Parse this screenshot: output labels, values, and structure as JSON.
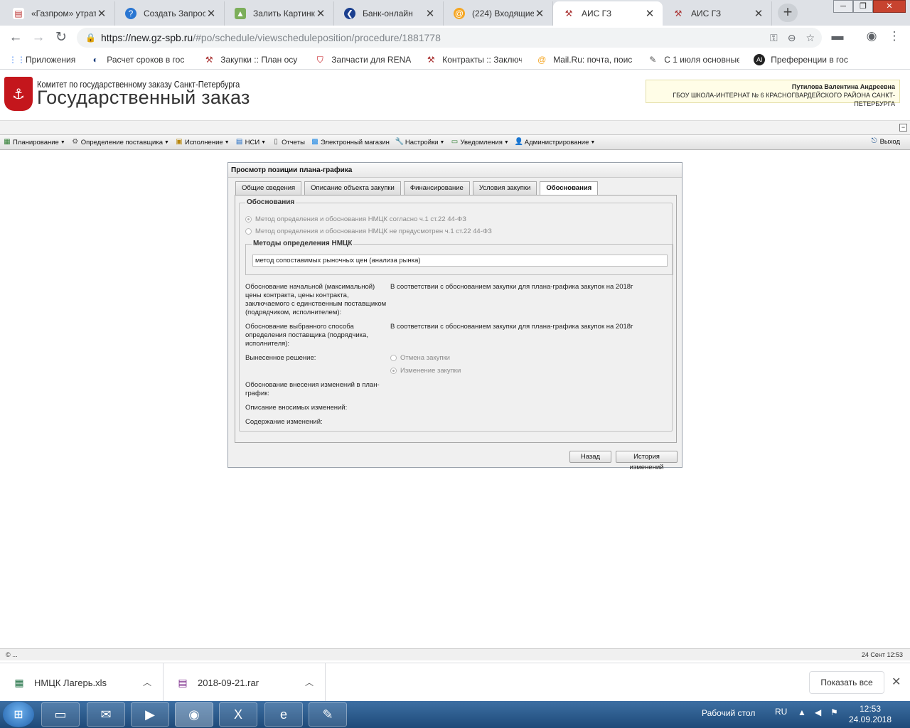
{
  "browser": {
    "tabs": [
      {
        "title": "«Газпром» утрат",
        "icon": "news-icon",
        "active": false
      },
      {
        "title": "Создать Запрос",
        "icon": "globe-icon",
        "active": false
      },
      {
        "title": "Залить Картинку",
        "icon": "image-icon",
        "active": false
      },
      {
        "title": "Банк-онлайн",
        "icon": "bank-icon",
        "active": false
      },
      {
        "title": "(224) Входящие",
        "icon": "mail-icon",
        "active": false
      },
      {
        "title": "АИС ГЗ",
        "icon": "gavel-icon",
        "active": true
      },
      {
        "title": "АИС ГЗ",
        "icon": "gavel-icon",
        "active": false
      }
    ],
    "url_host": "https://new.gz-spb.ru",
    "url_path": "/#po/schedule/viewscheduleposition/procedure/1881778",
    "bookmarks": [
      {
        "label": "Приложения",
        "icon": "apps-icon"
      },
      {
        "label": "Расчет сроков в гос",
        "icon": "calc-icon"
      },
      {
        "label": "Закупки :: План осу",
        "icon": "gavel-icon"
      },
      {
        "label": "Запчасти для RENAU",
        "icon": "shield-icon"
      },
      {
        "label": "Контракты :: Заключ",
        "icon": "gavel-icon"
      },
      {
        "label": "Mail.Ru: почта, поис",
        "icon": "mail-icon"
      },
      {
        "label": "С 1 июля основные",
        "icon": "pen-icon"
      },
      {
        "label": "Преференции в гос",
        "icon": "circle-icon"
      }
    ]
  },
  "header": {
    "org_line1": "Комитет по государственному заказу Санкт-Петербурга",
    "org_line2": "Государственный заказ",
    "user_name": "Путилова Валентина Андреевна",
    "user_org": "ГБОУ ШКОЛА-ИНТЕРНАТ № 6 КРАСНОГВАРДЕЙСКОГО РАЙОНА САНКТ-ПЕТЕРБУРГА"
  },
  "menu": {
    "items": [
      {
        "label": "Планирование",
        "dropdown": true
      },
      {
        "label": "Определение поставщика",
        "dropdown": true
      },
      {
        "label": "Исполнение",
        "dropdown": true
      },
      {
        "label": "НСИ",
        "dropdown": true
      },
      {
        "label": "Отчеты",
        "dropdown": false
      },
      {
        "label": "Электронный магазин",
        "dropdown": false
      },
      {
        "label": "Настройки",
        "dropdown": true
      },
      {
        "label": "Уведомления",
        "dropdown": true
      },
      {
        "label": "Администрирование",
        "dropdown": true
      }
    ],
    "exit": "Выход"
  },
  "panel": {
    "title": "Просмотр позиции плана-графика",
    "tabs": [
      "Общие сведения",
      "Описание объекта закупки",
      "Финансирование",
      "Условия закупки",
      "Обоснования"
    ],
    "active_tab": "Обоснования",
    "section_title": "Обоснования",
    "radio1": "Метод определения и обоснования НМЦК согласно ч.1 ст.22 44-ФЗ",
    "radio2": "Метод определения и обоснования НМЦК не предусмотрен ч.1 ст.22 44-ФЗ",
    "methods_title": "Методы определения НМЦК",
    "method_value": "метод сопоставимых рыночных цен (анализа рынка)",
    "field1_label": "Обоснование начальной (максимальной) цены контракта, цены контракта, заключаемого с единственным поставщиком (подрядчиком, исполнителем):",
    "field1_value": "В соответствии с обоснованием закупки для плана-графика закупок на 2018г",
    "field2_label": "Обоснование выбранного способа определения поставщика (подрядчика, исполнителя):",
    "field2_value": "В соответствии с обоснованием закупки для плана-графика закупок на 2018г",
    "decision_label": "Вынесенное решение:",
    "decision_opt1": "Отмена закупки",
    "decision_opt2": "Изменение закупки",
    "change_reason_label": "Обоснование внесения изменений в план-график:",
    "change_desc_label": "Описание вносимых изменений:",
    "change_content_label": "Содержание изменений:",
    "btn_back": "Назад",
    "btn_history": "История изменений"
  },
  "status": {
    "left": "© ...",
    "right": "24 Сент 12:53"
  },
  "downloads": {
    "items": [
      {
        "name": "НМЦК Лагерь.xls",
        "icon": "excel-icon"
      },
      {
        "name": "2018-09-21.rar",
        "icon": "archive-icon"
      }
    ],
    "show_all": "Показать все"
  },
  "taskbar": {
    "desktop_label": "Рабочий стол",
    "lang": "RU",
    "time": "12:53",
    "date": "24.09.2018"
  }
}
